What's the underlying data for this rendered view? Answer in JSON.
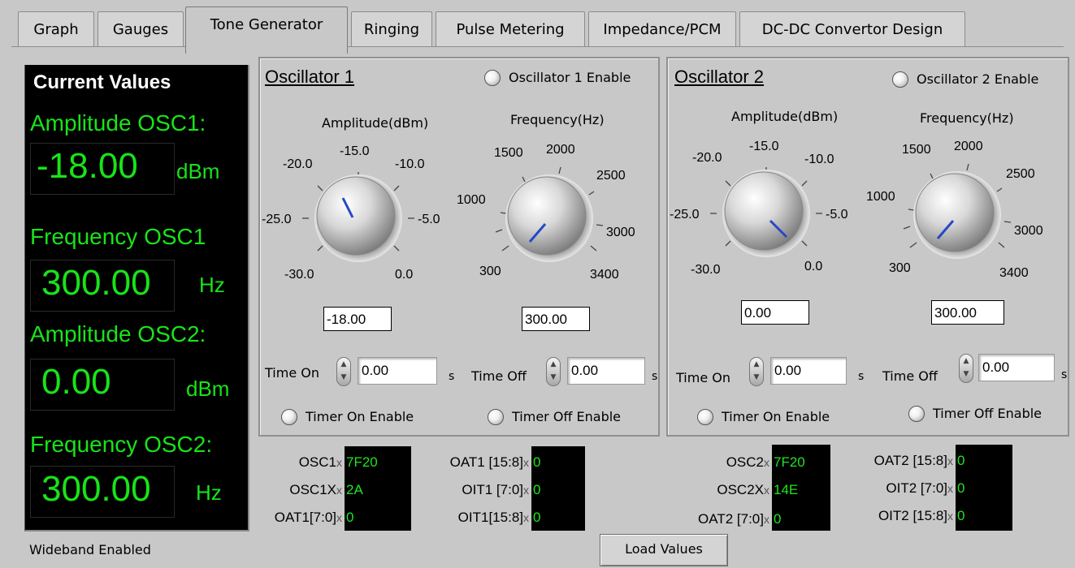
{
  "tabs": [
    {
      "label": "Graph"
    },
    {
      "label": "Gauges"
    },
    {
      "label": "Tone Generator"
    },
    {
      "label": "Ringing"
    },
    {
      "label": "Pulse Metering"
    },
    {
      "label": "Impedance/PCM"
    },
    {
      "label": "DC-DC Convertor Design"
    }
  ],
  "current_values": {
    "title": "Current Values",
    "amp_osc1_label": "Amplitude OSC1:",
    "amp_osc1_value": "-18.00",
    "amp_osc1_unit": "dBm",
    "freq_osc1_label": "Frequency OSC1",
    "freq_osc1_value": "300.00",
    "freq_osc1_unit": "Hz",
    "amp_osc2_label": "Amplitude OSC2:",
    "amp_osc2_value": "0.00",
    "amp_osc2_unit": "dBm",
    "freq_osc2_label": "Frequency OSC2:",
    "freq_osc2_value": "300.00",
    "freq_osc2_unit": "Hz",
    "text_color": "#18e418"
  },
  "osc1": {
    "title": "Oscillator 1",
    "enable_label": "Oscillator 1 Enable",
    "amp_label": "Amplitude(dBm)",
    "freq_label": "Frequency(Hz)",
    "amp_value": "-18.00",
    "freq_value": "300.00",
    "time_on_label": "Time On",
    "time_on_value": "0.00",
    "time_off_label": "Time Off",
    "time_off_value": "0.00",
    "unit_s": "s",
    "timer_on_enable": "Timer On Enable",
    "timer_off_enable": "Timer Off Enable",
    "amp_scale": [
      "-30.0",
      "-25.0",
      "-20.0",
      "-15.0",
      "-10.0",
      "-5.0",
      "0.0"
    ],
    "freq_scale": [
      "300",
      "1000",
      "1500",
      "2000",
      "2500",
      "3000",
      "3400"
    ]
  },
  "osc2": {
    "title": "Oscillator 2",
    "enable_label": "Oscillator 2 Enable",
    "amp_label": "Amplitude(dBm)",
    "freq_label": "Frequency(Hz)",
    "amp_value": "0.00",
    "freq_value": "300.00",
    "time_on_label": "Time On",
    "time_on_value": "0.00",
    "time_off_label": "Time Off",
    "time_off_value": "0.00",
    "unit_s": "s",
    "timer_on_enable": "Timer On Enable",
    "timer_off_enable": "Timer Off Enable",
    "amp_scale": [
      "-30.0",
      "-25.0",
      "-20.0",
      "-15.0",
      "-10.0",
      "-5.0",
      "0.0"
    ],
    "freq_scale": [
      "300",
      "1000",
      "1500",
      "2000",
      "2500",
      "3000",
      "3400"
    ]
  },
  "registers1": [
    {
      "label": "OSC1",
      "value": "7F20"
    },
    {
      "label": "OSC1X",
      "value": "2A"
    },
    {
      "label": "OAT1[7:0]",
      "value": "0"
    },
    {
      "label": "OAT1 [15:8]",
      "value": "0"
    },
    {
      "label": "OIT1 [7:0]",
      "value": "0"
    },
    {
      "label": "OIT1[15:8]",
      "value": "0"
    }
  ],
  "registers2": [
    {
      "label": "OSC2",
      "value": "7F20"
    },
    {
      "label": "OSC2X",
      "value": "14E"
    },
    {
      "label": "OAT2 [7:0]",
      "value": "0"
    },
    {
      "label": "OAT2 [15:8]",
      "value": "0"
    },
    {
      "label": "OIT2 [7:0]",
      "value": "0"
    },
    {
      "label": "OIT2 [15:8]",
      "value": "0"
    }
  ],
  "reg_prefix": "x",
  "status": {
    "wideband": "Wideband Enabled"
  },
  "load_button": "Load Values"
}
